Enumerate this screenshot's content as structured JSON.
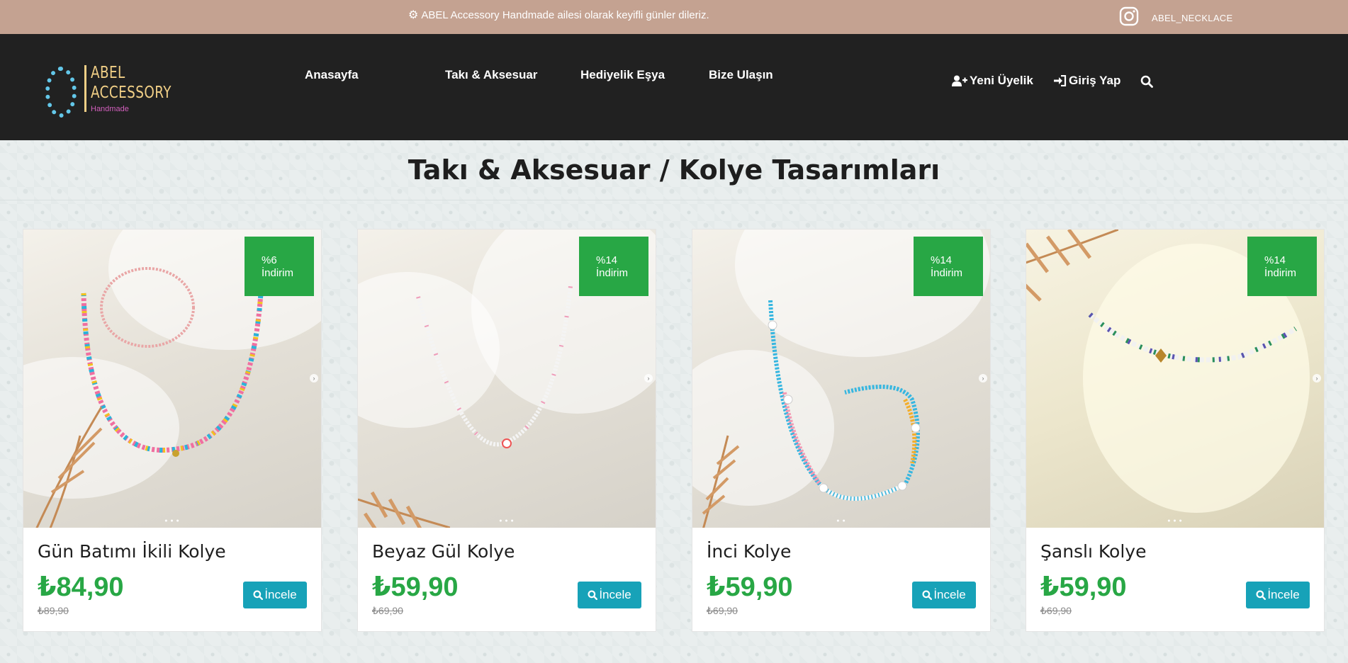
{
  "topbar": {
    "announcement": "ABEL Accessory Handmade ailesi olarak keyifli günler dileriz.",
    "instagram_handle": "ABEL_NECKLACE"
  },
  "logo": {
    "line1": "ABEL",
    "line2": "ACCESSORY",
    "line3": "Handmade"
  },
  "nav": {
    "items": [
      {
        "label": "Anasayfa"
      },
      {
        "label": "Takı & Aksesuar"
      },
      {
        "label": "Hediyelik Eşya"
      },
      {
        "label": "Bize Ulaşın"
      }
    ]
  },
  "actions": {
    "register": "Yeni Üyelik",
    "login": "Giriş Yap"
  },
  "page": {
    "title": "Takı & Aksesuar / Kolye Tasarımları"
  },
  "products": [
    {
      "name": "Gün Batımı İkili Kolye",
      "price": "₺84,90",
      "old_price": "₺89,90",
      "badge_pct": "%6",
      "badge_label": "İndirim",
      "button": "İncele"
    },
    {
      "name": "Beyaz Gül Kolye",
      "price": "₺59,90",
      "old_price": "₺69,90",
      "badge_pct": "%14",
      "badge_label": "İndirim",
      "button": "İncele"
    },
    {
      "name": "İnci Kolye",
      "price": "₺59,90",
      "old_price": "₺69,90",
      "badge_pct": "%14",
      "badge_label": "İndirim",
      "button": "İncele"
    },
    {
      "name": "Şanslı Kolye",
      "price": "₺59,90",
      "old_price": "₺69,90",
      "badge_pct": "%14",
      "badge_label": "İndirim",
      "button": "İncele"
    }
  ],
  "colors": {
    "topbar": "#c4a291",
    "header": "#212121",
    "badge": "#28a745",
    "price": "#28a745",
    "button": "#17a2b8"
  }
}
